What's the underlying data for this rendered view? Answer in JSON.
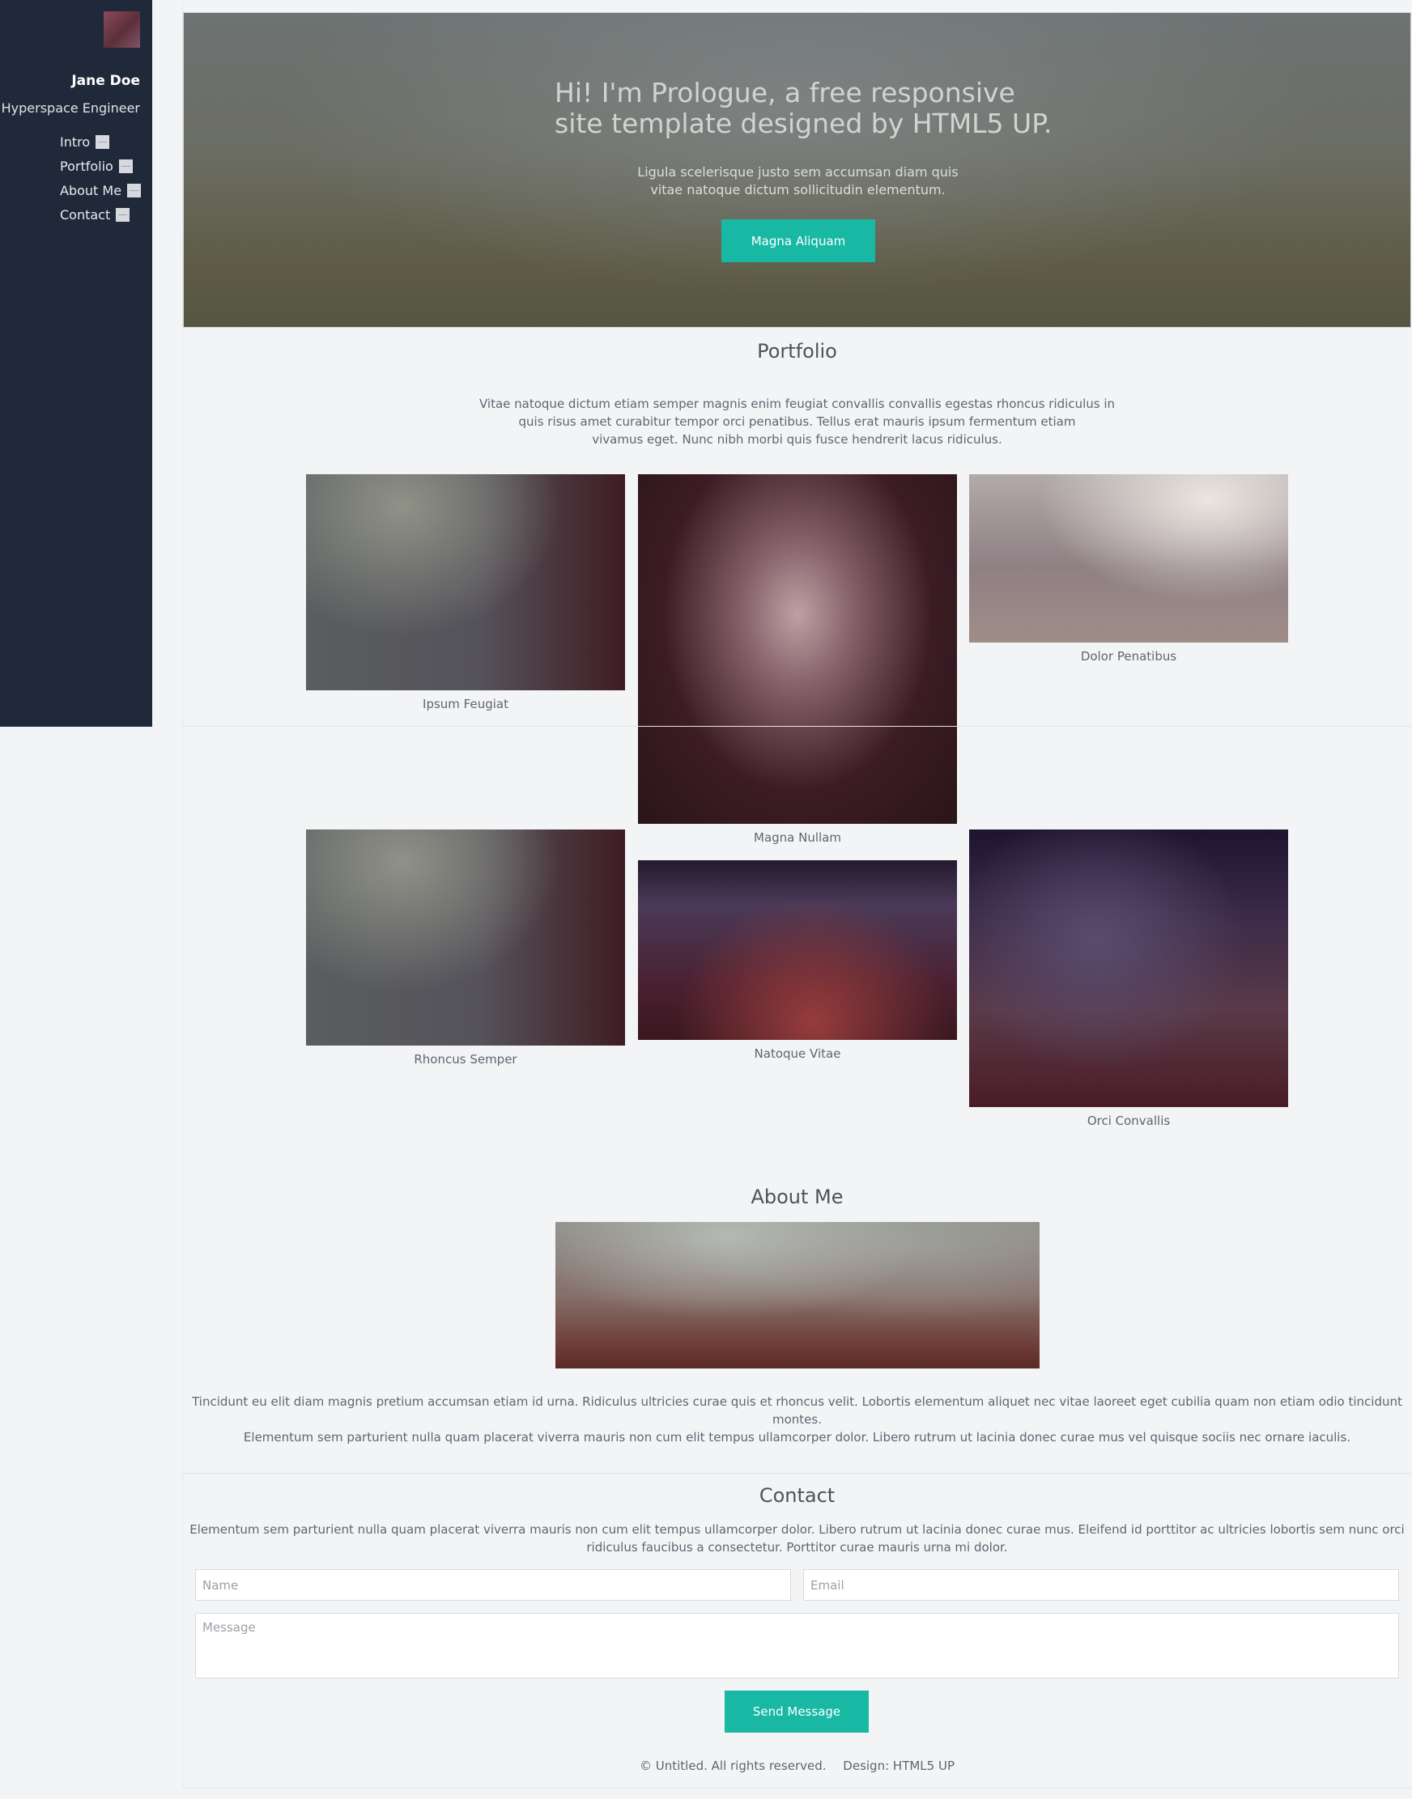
{
  "sidebar": {
    "name": "Jane Doe",
    "role": "Hyperspace Engineer",
    "nav": [
      {
        "label": "Intro",
        "icon": "home-icon"
      },
      {
        "label": "Portfolio",
        "icon": "grid-icon"
      },
      {
        "label": "About Me",
        "icon": "user-icon"
      },
      {
        "label": "Contact",
        "icon": "envelope-icon"
      }
    ]
  },
  "hero": {
    "headline_line1": "Hi! I'm Prologue, a free responsive",
    "headline_line2": "site template designed by HTML5 UP.",
    "sub_line1": "Ligula scelerisque justo sem accumsan diam quis",
    "sub_line2": "vitae natoque dictum sollicitudin elementum.",
    "button": "Magna Aliquam"
  },
  "portfolio": {
    "title": "Portfolio",
    "text_line1": "Vitae natoque dictum etiam semper magnis enim feugiat convallis convallis egestas rhoncus ridiculus in",
    "text_line2": "quis risus amet curabitur tempor orci penatibus. Tellus erat mauris ipsum fermentum etiam",
    "text_line3": "vivamus eget. Nunc nibh morbi quis fusce hendrerit lacus ridiculus.",
    "items": [
      {
        "caption": "Ipsum Feugiat"
      },
      {
        "caption": "Magna Nullam"
      },
      {
        "caption": "Dolor Penatibus"
      },
      {
        "caption": "Rhoncus Semper"
      },
      {
        "caption": "Natoque Vitae"
      },
      {
        "caption": "Orci Convallis"
      }
    ]
  },
  "about": {
    "title": "About Me",
    "text_line1": "Tincidunt eu elit diam magnis pretium accumsan etiam id urna. Ridiculus ultricies curae quis et rhoncus velit. Lobortis elementum aliquet nec vitae laoreet eget cubilia quam non etiam odio tincidunt montes.",
    "text_line2": "Elementum sem parturient nulla quam placerat viverra mauris non cum elit tempus ullamcorper dolor. Libero rutrum ut lacinia donec curae mus vel quisque sociis nec ornare iaculis."
  },
  "contact": {
    "title": "Contact",
    "text_line1": "Elementum sem parturient nulla quam placerat viverra mauris non cum elit tempus ullamcorper dolor. Libero rutrum ut lacinia donec curae mus. Eleifend id porttitor ac ultricies lobortis sem nunc orci",
    "text_line2": "ridiculus faucibus a consectetur. Porttitor curae mauris urna mi dolor.",
    "name_placeholder": "Name",
    "email_placeholder": "Email",
    "message_placeholder": "Message",
    "send_button": "Send Message"
  },
  "footer": {
    "copyright": "© Untitled. All rights reserved.",
    "design": "Design: HTML5 UP"
  },
  "colors": {
    "sidebar_bg": "#1f2939",
    "accent": "#18b8a5",
    "page_bg": "#f3f4f6"
  }
}
